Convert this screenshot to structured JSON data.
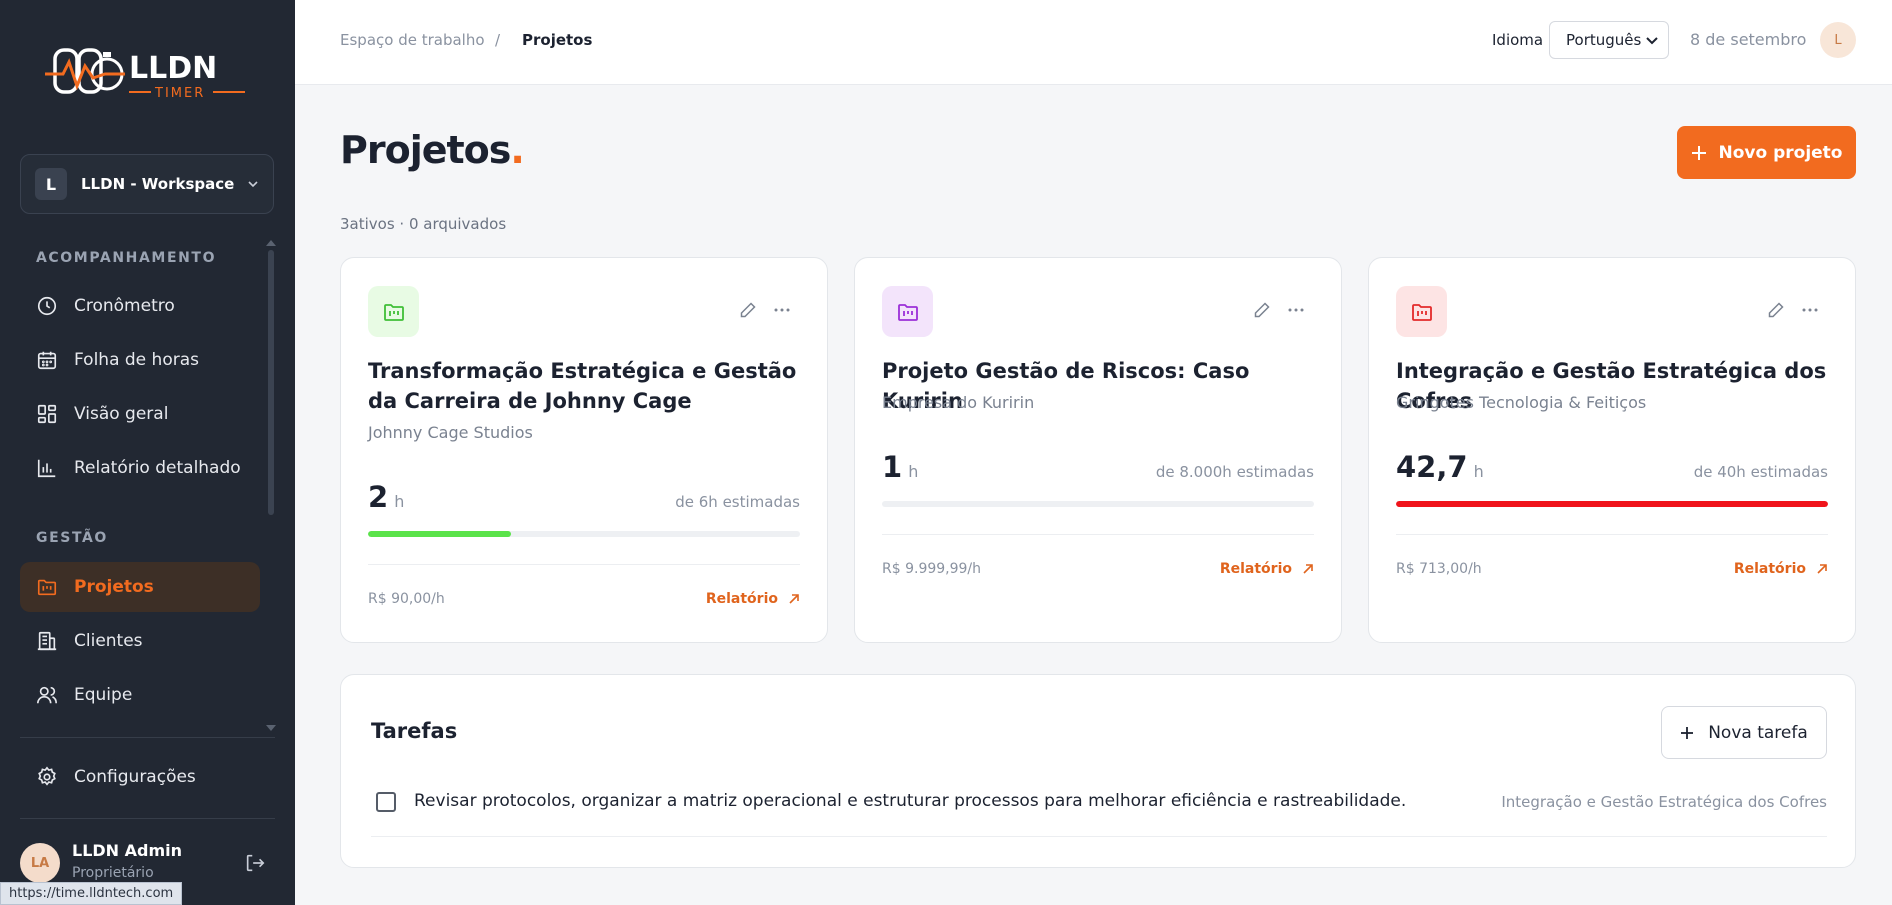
{
  "sidebar": {
    "workspace": {
      "initial": "L",
      "name": "LLDN - Workspace De"
    },
    "sections": [
      {
        "title": "ACOMPANHAMENTO",
        "items": [
          {
            "label": "Cronômetro",
            "icon": "clock-icon"
          },
          {
            "label": "Folha de horas",
            "icon": "calendar-icon"
          },
          {
            "label": "Visão geral",
            "icon": "grid-icon"
          },
          {
            "label": "Relatório detalhado",
            "icon": "bar-chart-icon"
          }
        ]
      },
      {
        "title": "GESTÃO",
        "items": [
          {
            "label": "Projetos",
            "icon": "folder-icon",
            "active": true
          },
          {
            "label": "Clientes",
            "icon": "building-icon"
          },
          {
            "label": "Equipe",
            "icon": "users-icon"
          }
        ]
      }
    ],
    "settings": "Configurações",
    "user": {
      "initials": "LA",
      "name": "LLDN Admin",
      "role": "Proprietário"
    },
    "status_url": "https://time.lldntech.com"
  },
  "topbar": {
    "breadcrumb": [
      "Espaço de trabalho",
      "/",
      "Projetos"
    ],
    "language_label": "Idioma",
    "language_value": "Português",
    "date": "8 de setembro",
    "avatar_initial": "L"
  },
  "main": {
    "title": "Projetos",
    "title_dot": ".",
    "new_project_label": "Novo projeto",
    "summary": "3ativos · 0 arquivados",
    "projects": [
      {
        "title": "Transformação Estratégica e Gestão da Carreira de Johnny Cage",
        "client": "Johnny Cage Studios",
        "hours": "2",
        "hours_unit": "h",
        "estimate": "de 6h estimadas",
        "progress": 0.33,
        "rate": "R$ 90,00/h",
        "report_label": "Relatório",
        "color": "#5ae34a",
        "icon_bg": "#e8fbe4",
        "icon_color": "#3fbf36"
      },
      {
        "title": "Projeto Gestão de Riscos: Caso Kuririn",
        "client": "Empresa do Kuririn",
        "hours": "1",
        "hours_unit": "h",
        "estimate": "de 8.000h estimadas",
        "progress": 0.0,
        "rate": "R$ 9.999,99/h",
        "report_label": "Relatório",
        "color": "#a335e0",
        "icon_bg": "#f3e4fb",
        "icon_color": "#9b2fd8"
      },
      {
        "title": "Integração e Gestão Estratégica dos Cofres",
        "client": "Gringotes Tecnologia & Feitiços",
        "hours": "42,7",
        "hours_unit": "h",
        "estimate": "de 40h estimadas",
        "progress": 1.0,
        "rate": "R$ 713,00/h",
        "report_label": "Relatório",
        "color": "#f0141b",
        "icon_bg": "#fde4e4",
        "icon_color": "#e32a2a"
      }
    ],
    "tasks": {
      "title": "Tarefas",
      "new_task_label": "Nova tarefa",
      "items": [
        {
          "text": "Revisar protocolos, organizar a matriz operacional e estruturar processos para melhorar eficiência e rastreabilidade.",
          "project": "Integração e Gestão Estratégica dos Cofres"
        }
      ]
    }
  },
  "colors": {
    "accent": "#f26b1f",
    "sidebar_bg": "#222833"
  }
}
